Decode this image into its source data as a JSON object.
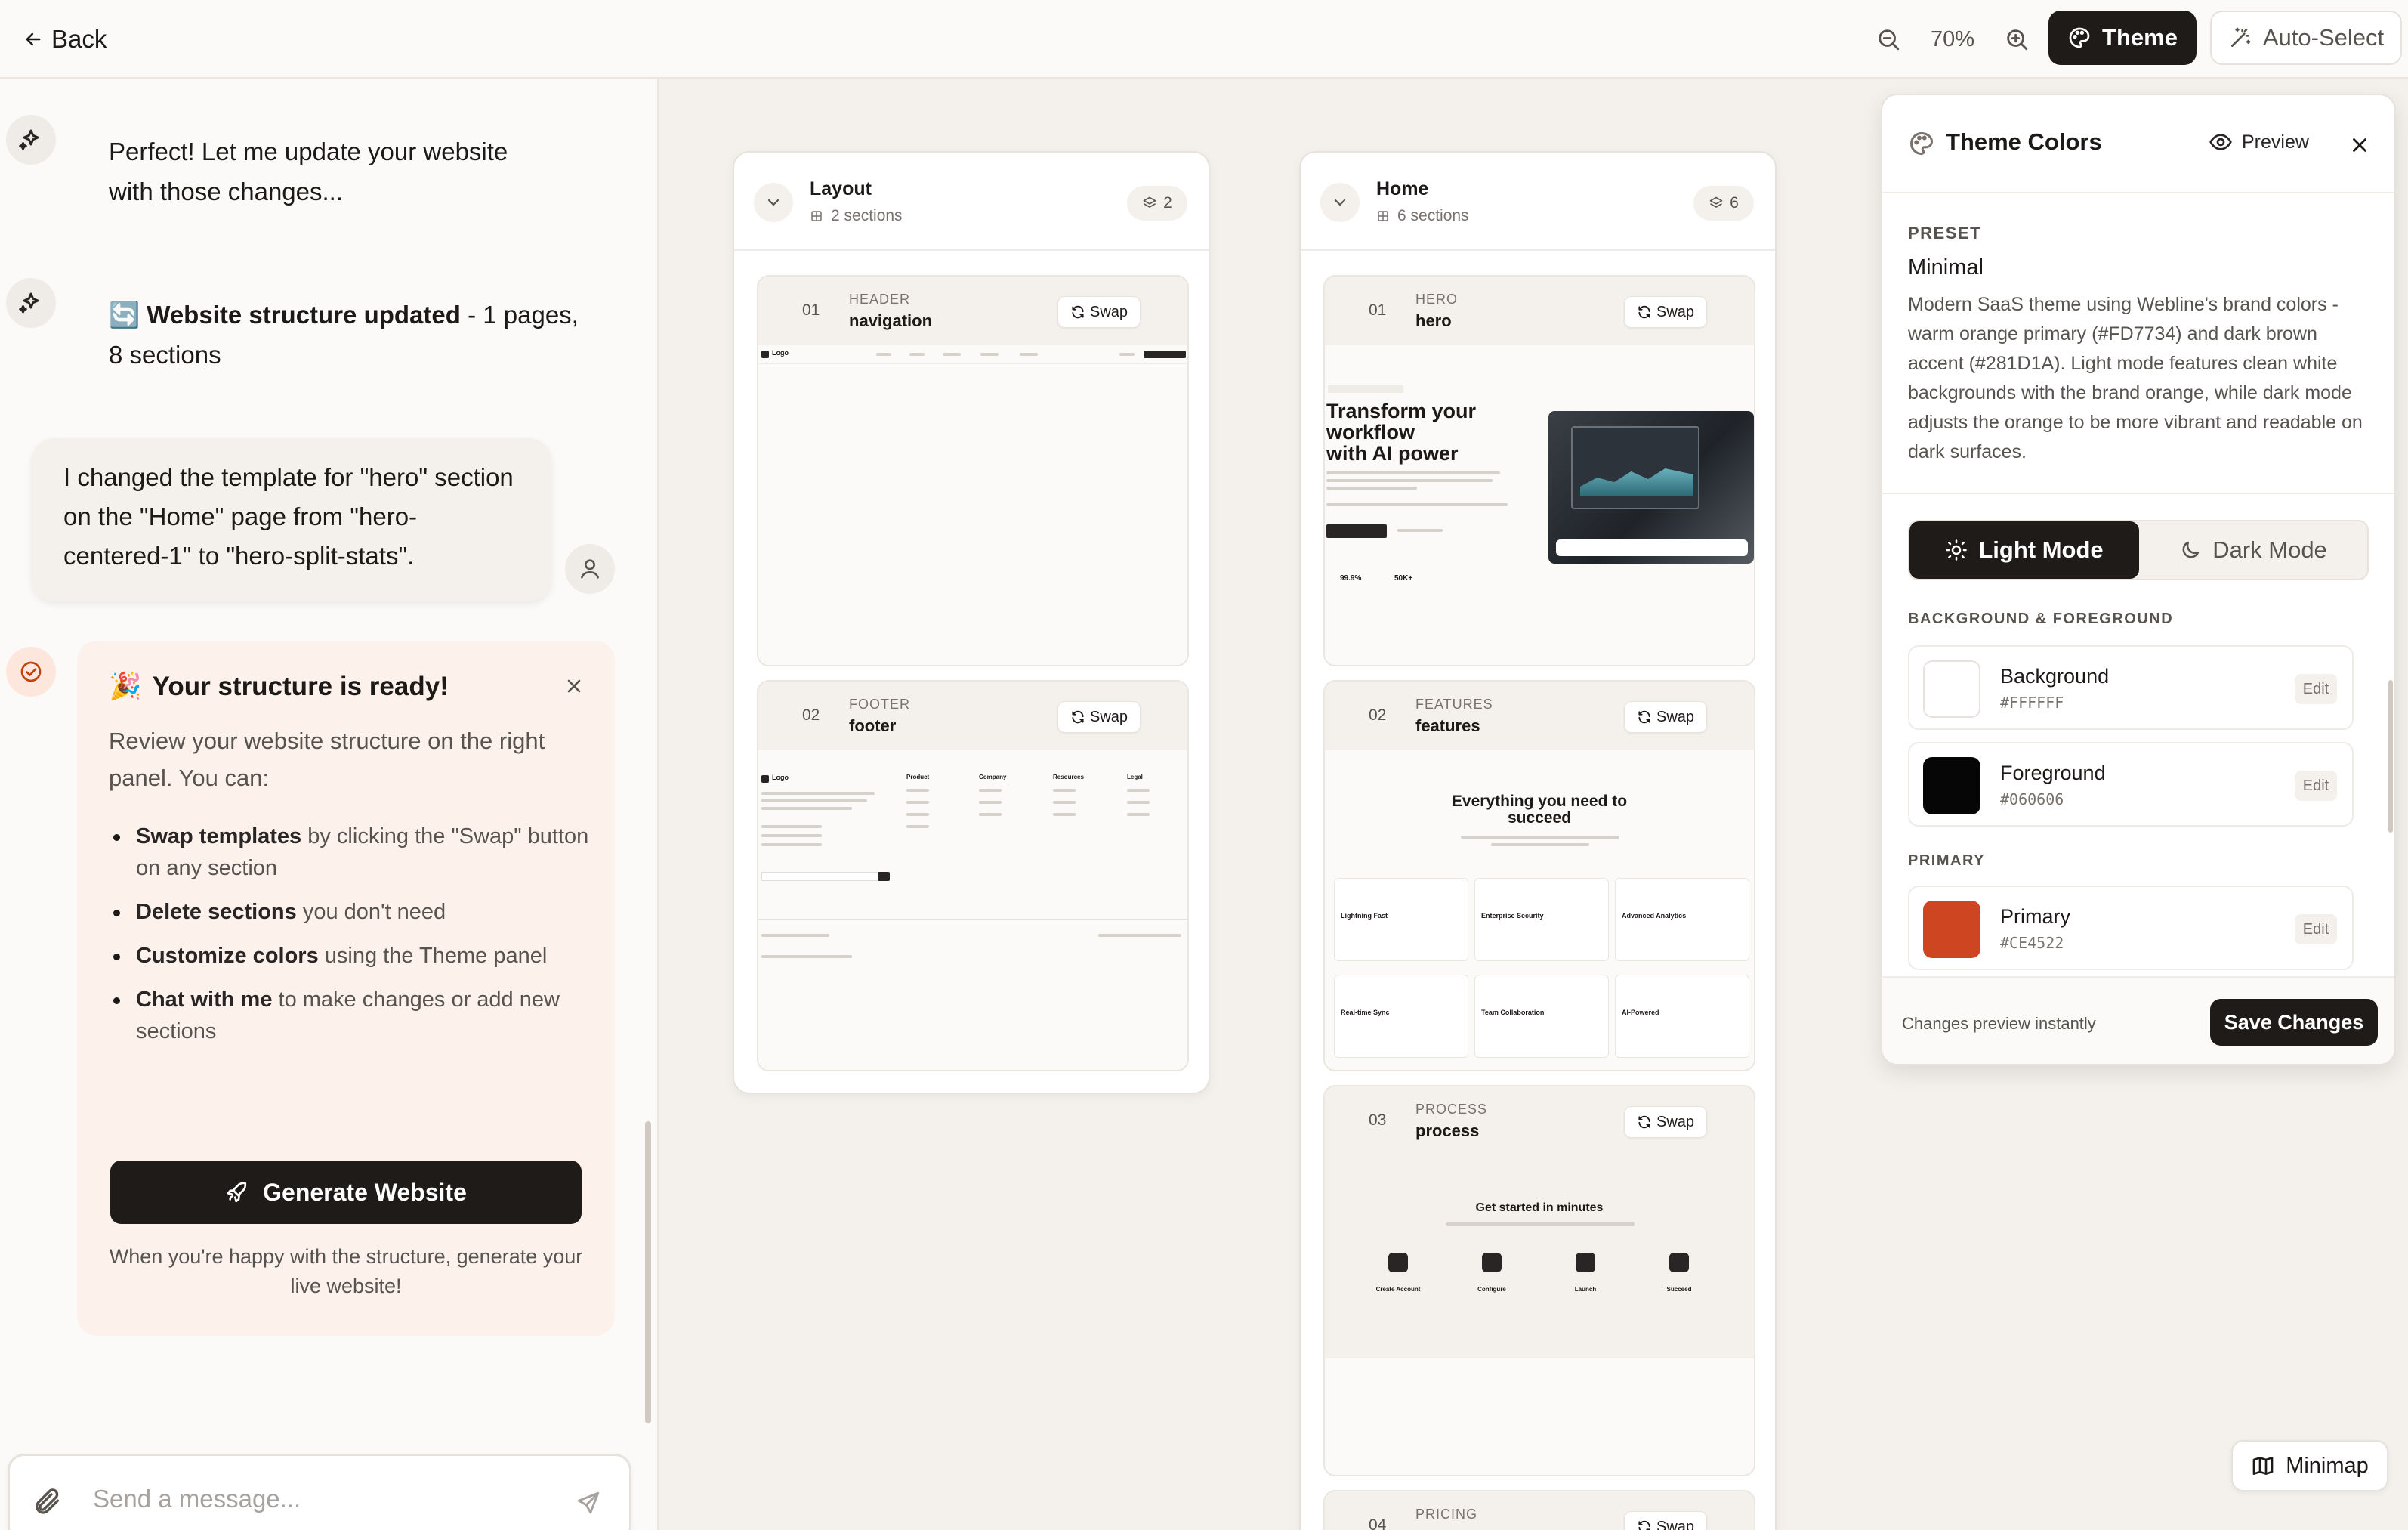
{
  "topbar": {
    "back_label": "Back",
    "zoom_level": "70%",
    "theme_label": "Theme",
    "auto_select_label": "Auto-Select"
  },
  "chat": {
    "messages": [
      {
        "role": "assistant",
        "text_line1": "Perfect! Let me update your website",
        "text_line2": "with those changes..."
      },
      {
        "role": "assistant",
        "emoji": "🔄",
        "bold": "Website structure updated",
        "rest": " - 1 pages,",
        "line2": "8 sections"
      },
      {
        "role": "user",
        "text": "I changed the template for \"hero\" section on the \"Home\" page from \"hero-centered-1\" to \"hero-split-stats\"."
      }
    ],
    "ready_card": {
      "emoji": "🎉",
      "title": "Your structure is ready!",
      "description": "Review your website structure on the right panel. You can:",
      "items": [
        {
          "bold": "Swap templates",
          "rest": " by clicking the \"Swap\" button on any section"
        },
        {
          "bold": "Delete sections",
          "rest": " you don't need"
        },
        {
          "bold": "Customize colors",
          "rest": " using the Theme panel"
        },
        {
          "bold": "Chat with me",
          "rest": " to make changes or add new sections"
        }
      ],
      "generate_label": "Generate Website",
      "note": "When you're happy with the structure, generate your live website!"
    },
    "composer_placeholder": "Send a message..."
  },
  "pages": [
    {
      "name": "Layout",
      "subtitle": "2 sections",
      "count": "2",
      "sections": [
        {
          "num": "01",
          "type": "HEADER",
          "name": "navigation",
          "swap": "Swap"
        },
        {
          "num": "02",
          "type": "FOOTER",
          "name": "footer",
          "swap": "Swap"
        }
      ]
    },
    {
      "name": "Home",
      "subtitle": "6 sections",
      "count": "6",
      "sections": [
        {
          "num": "01",
          "type": "HERO",
          "name": "hero",
          "swap": "Swap",
          "preview_title": "Transform your workflow with AI power"
        },
        {
          "num": "02",
          "type": "FEATURES",
          "name": "features",
          "swap": "Swap",
          "preview_title": "Everything you need to succeed"
        },
        {
          "num": "03",
          "type": "PROCESS",
          "name": "process",
          "swap": "Swap",
          "preview_title": "Get started in minutes"
        },
        {
          "num": "04",
          "type": "PRICING",
          "name": "",
          "swap": "Swap"
        }
      ]
    }
  ],
  "preview_text": {
    "logo": "Logo",
    "hero_line1": "Transform your",
    "hero_line2": "workflow",
    "hero_line3": "with AI power",
    "features_line1": "Everything you need to",
    "features_line2": "succeed",
    "features_cards": [
      "Lightning Fast",
      "Enterprise Security",
      "Advanced Analytics",
      "Real-time Sync",
      "Team Collaboration",
      "AI-Powered"
    ],
    "process_title": "Get started in minutes",
    "process_steps": [
      "Create Account",
      "Configure",
      "Launch",
      "Succeed"
    ],
    "stats": [
      "99.9%",
      "50K+"
    ],
    "footer_cols": [
      "Product",
      "Company",
      "Resources",
      "Legal"
    ]
  },
  "theme_panel": {
    "title": "Theme Colors",
    "preview_label": "Preview",
    "preset_label": "PRESET",
    "preset_name": "Minimal",
    "preset_description": "Modern SaaS theme using Webline's brand colors - warm orange primary (#FD7734) and dark brown accent (#281D1A). Light mode features clean white backgrounds with the brand orange, while dark mode adjusts the orange to be more vibrant and readable on dark surfaces.",
    "light_mode_label": "Light Mode",
    "dark_mode_label": "Dark Mode",
    "bg_fg_label": "BACKGROUND & FOREGROUND",
    "primary_label": "PRIMARY",
    "colors": [
      {
        "name": "Background",
        "hex": "#FFFFFF",
        "edit": "Edit"
      },
      {
        "name": "Foreground",
        "hex": "#060606",
        "edit": "Edit"
      },
      {
        "name": "Primary",
        "hex": "#CE4522",
        "edit": "Edit"
      }
    ],
    "footer_note": "Changes preview instantly",
    "save_label": "Save Changes"
  },
  "minimap_label": "Minimap"
}
